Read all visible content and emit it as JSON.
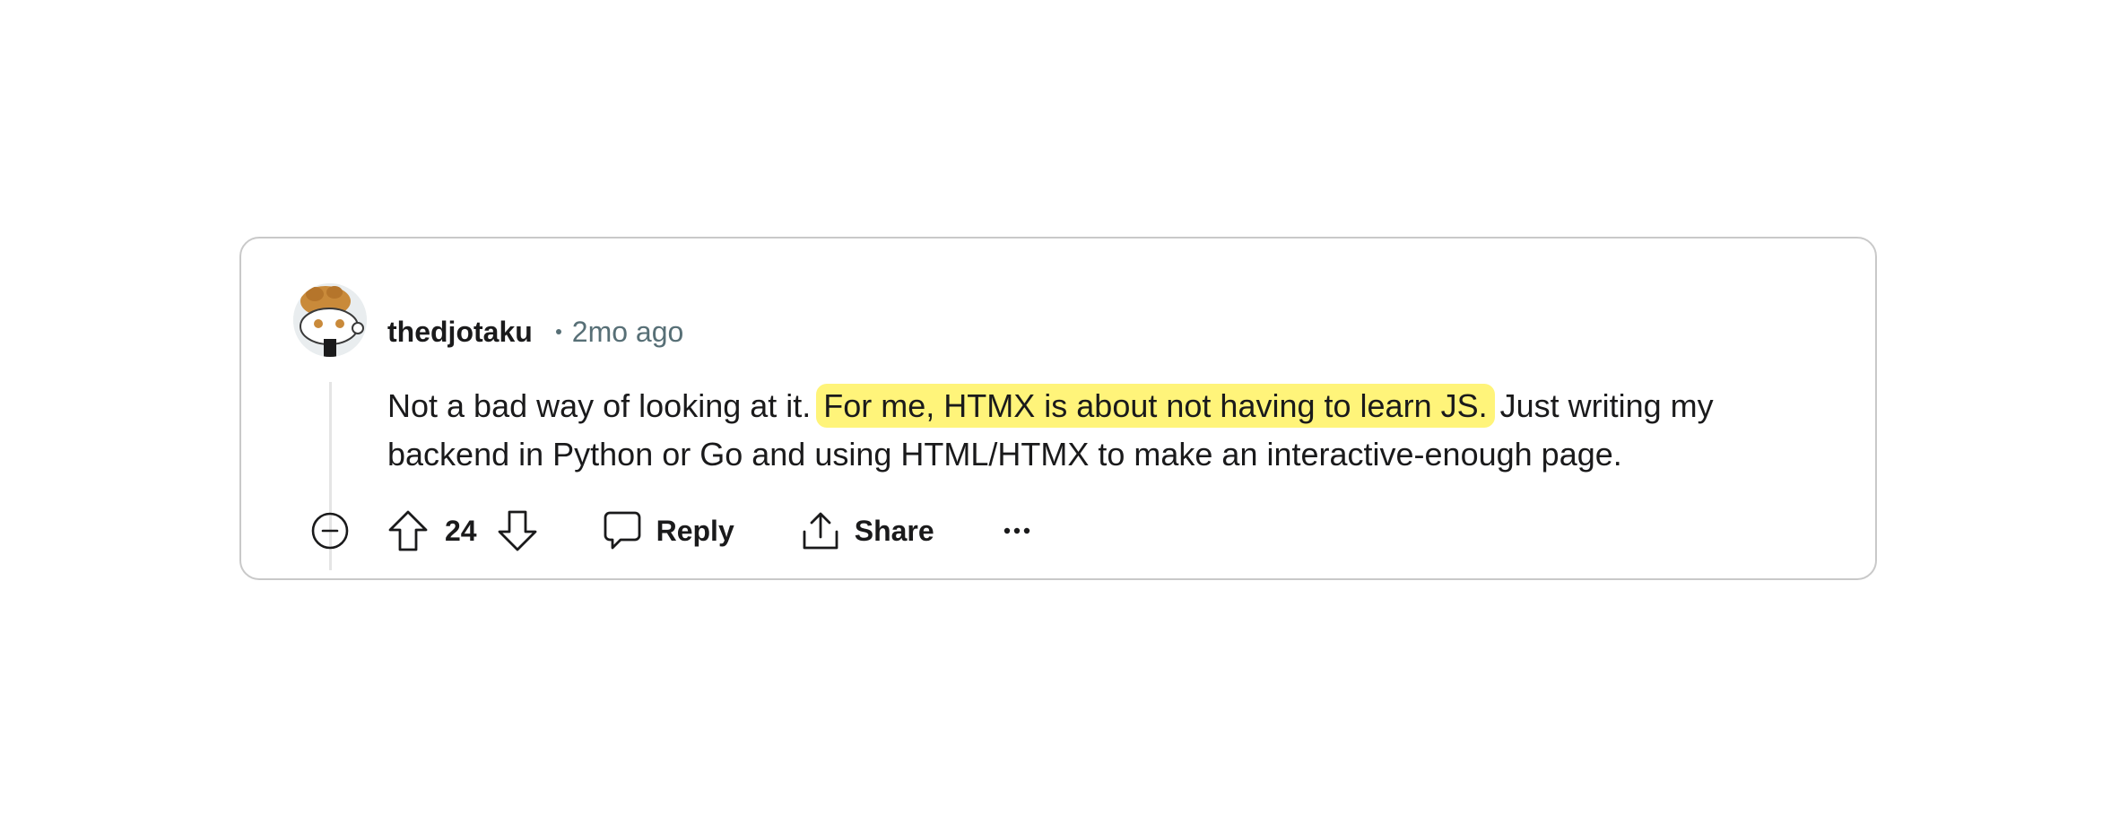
{
  "comment": {
    "username": "thedjotaku",
    "separator": "•",
    "time": "2mo ago",
    "text_before": "Not a bad way of looking at it. ",
    "text_highlight": "For me, HTMX is about not having to learn JS.",
    "text_after": " Just writing my backend in Python or Go and using HTML/HTMX to make an interactive-enough page.",
    "highlight_color": "#fff47a"
  },
  "actions": {
    "score": "24",
    "reply_label": "Reply",
    "share_label": "Share"
  },
  "icons": {
    "avatar": "snoo-avatar",
    "collapse": "minus-circle-icon",
    "upvote": "arrow-up-icon",
    "downvote": "arrow-down-icon",
    "reply": "comment-bubble-icon",
    "share": "share-upload-icon",
    "more": "ellipsis-icon"
  }
}
